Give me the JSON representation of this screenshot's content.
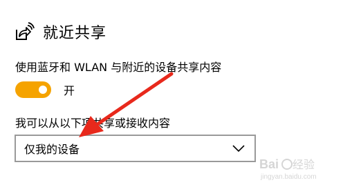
{
  "section": {
    "icon": "nearby-share-icon",
    "title": "就近共享"
  },
  "description": "使用蓝牙和 WLAN 与附近的设备共享内容",
  "toggle": {
    "state_label": "开",
    "on": true,
    "color": "#f5a300"
  },
  "dropdown": {
    "label": "我可以从以下项共享或接收内容",
    "selected": "仅我的设备",
    "icon": "chevron-down-icon"
  },
  "annotation": {
    "icon": "red-arrow-icon",
    "color": "#e8291c"
  },
  "watermark": {
    "text": "Baidu 经验",
    "subtext": "jingyan.baidu.com"
  }
}
